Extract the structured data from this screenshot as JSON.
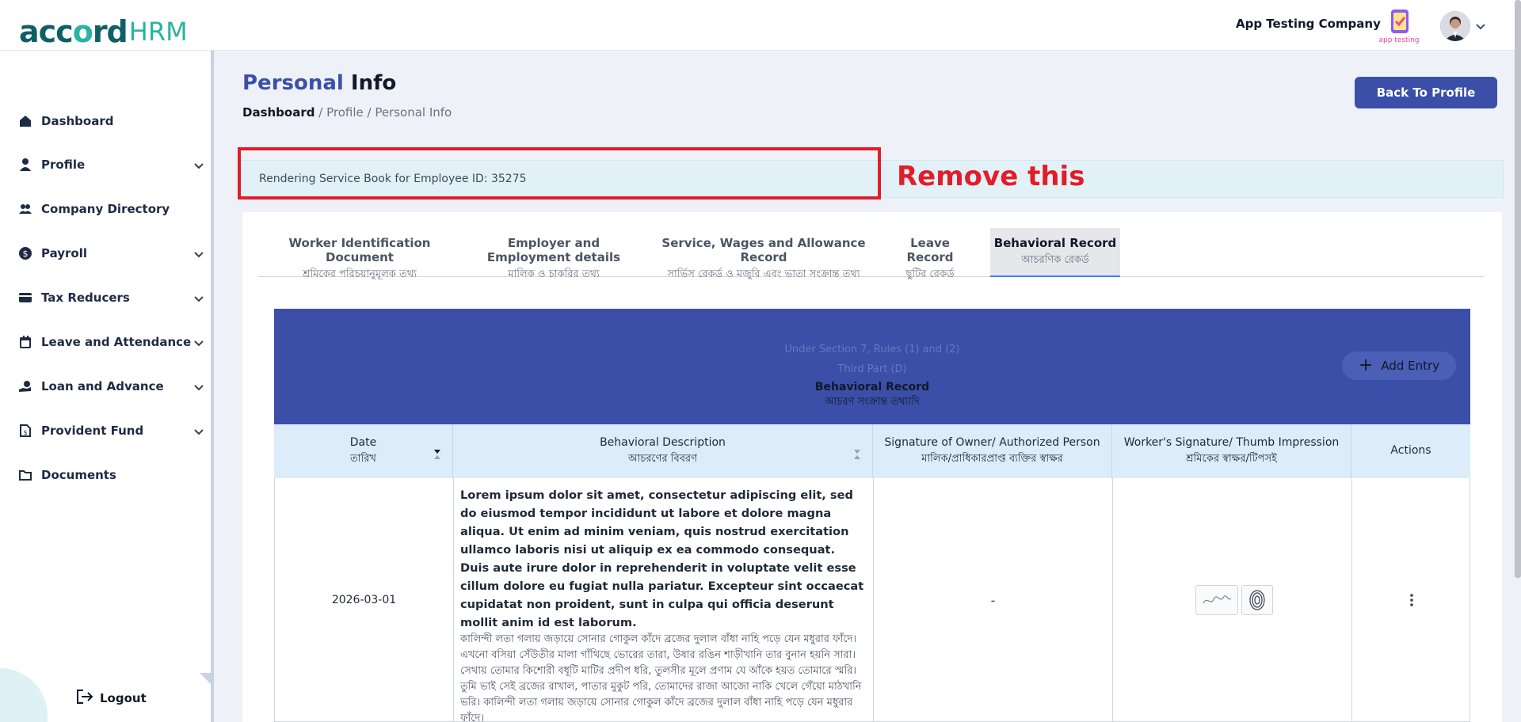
{
  "app": {
    "logo_main": "acc",
    "logo_o": "o",
    "logo_rd": "rd",
    "logo_hrm": "HRM",
    "company": "App Testing Company",
    "company_logo_text": "app testing"
  },
  "sidebar": {
    "items": [
      {
        "label": "Dashboard",
        "icon": "home-icon"
      },
      {
        "label": "Profile",
        "icon": "user-icon"
      },
      {
        "label": "Company Directory",
        "icon": "users-icon"
      },
      {
        "label": "Payroll",
        "icon": "dollar-icon"
      },
      {
        "label": "Tax Reducers",
        "icon": "card-icon"
      },
      {
        "label": "Leave and Attendance",
        "icon": "calendar-icon"
      },
      {
        "label": "Loan and Advance",
        "icon": "hand-coin-icon"
      },
      {
        "label": "Provident Fund",
        "icon": "document-dollar-icon"
      },
      {
        "label": "Documents",
        "icon": "folder-icon"
      }
    ],
    "logout": "Logout"
  },
  "header": {
    "title_part1": "Personal",
    "title_part2": "Info",
    "breadcrumb": {
      "home": "Dashboard",
      "sep": " / ",
      "profile": "Profile",
      "current": "Personal Info"
    },
    "back_button": "Back To Profile"
  },
  "banner": {
    "text": "Rendering Service Book for Employee ID: 35275",
    "annotation": "Remove this"
  },
  "tabs": [
    {
      "en": "Worker Identification Document",
      "bn": "শ্রমিকের পরিচয়ানুমূলক তথ্য"
    },
    {
      "en": "Employer and Employment details",
      "bn": "মালিক ও চাকরির তথ্য"
    },
    {
      "en": "Service, Wages and Allowance Record",
      "bn": "সার্ভিস রেকর্ড ও মজুরি এবং ভাতা সংক্রান্ত তথ্য"
    },
    {
      "en": "Leave Record",
      "bn": "ছুটির রেকর্ড"
    },
    {
      "en": "Behavioral Record",
      "bn": "আচরণিক রেকর্ড"
    }
  ],
  "table": {
    "sub1": "Under Section 7, Rules (1) and (2)",
    "sub2": "Third Part (D)",
    "title_en": "Behavioral Record",
    "title_bn": "আচরণ সংক্রান্ত তথ্যাদি",
    "add_button": "Add Entry",
    "columns": [
      {
        "en": "Date",
        "bn": "তারিখ"
      },
      {
        "en": "Behavioral Description",
        "bn": "আচরণের বিবরণ"
      },
      {
        "en": "Signature of Owner/ Authorized Person",
        "bn": "মালিক/প্রাধিকারপ্রাপ্ত ব্যক্তির স্বাক্ষর"
      },
      {
        "en": "Worker's Signature/ Thumb Impression",
        "bn": "শ্রমিকের স্বাক্ষর/টিপসই"
      },
      {
        "en": "Actions",
        "bn": ""
      }
    ],
    "rows": [
      {
        "date": "2026-03-01",
        "description_en": "Lorem ipsum dolor sit amet, consectetur adipiscing elit, sed do eiusmod tempor incididunt ut labore et dolore magna aliqua. Ut enim ad minim veniam, quis nostrud exercitation ullamco laboris nisi ut aliquip ex ea commodo consequat. Duis aute irure dolor in reprehenderit in voluptate velit esse cillum dolore eu fugiat nulla pariatur. Excepteur sint occaecat cupidatat non proident, sunt in culpa qui officia deserunt mollit anim id est laborum.",
        "description_bn": "কালিন্দী লতা গলায় জড়ায়ে সোনার গোকুল কাঁদে ব্রজের দুলাল বাঁধা নাহি পড়ে যেন মধুরার ফাঁদে। এখনো বসিয়া সেঁউতীর মালা গাঁথিছে ভোরের তারা, উষার রঙিন শাড়ীখানি তার বুনান হয়নি সারা। সেথায় তোমার কিশোরী বধূটি মাটির প্রদীপ ধরি, তুলসীর মূলে প্রণাম যে আঁকে হয়ত তোমারে স্মরি। তুমি ভাই সেই ব্রজের রাখাল, পাতার মুকুট পরি, তোমাদের রাজা আজো নাকি খেলে গেঁয়ো মাঠখানি ভরি। কালিন্দী লতা গলায় জড়ায়ে সোনার গোকুল কাঁদে ব্রজের দুলাল বাঁধা নাহি পড়ে যেন মধুরার ফাঁদে।",
        "owner_signature": "-"
      }
    ]
  }
}
